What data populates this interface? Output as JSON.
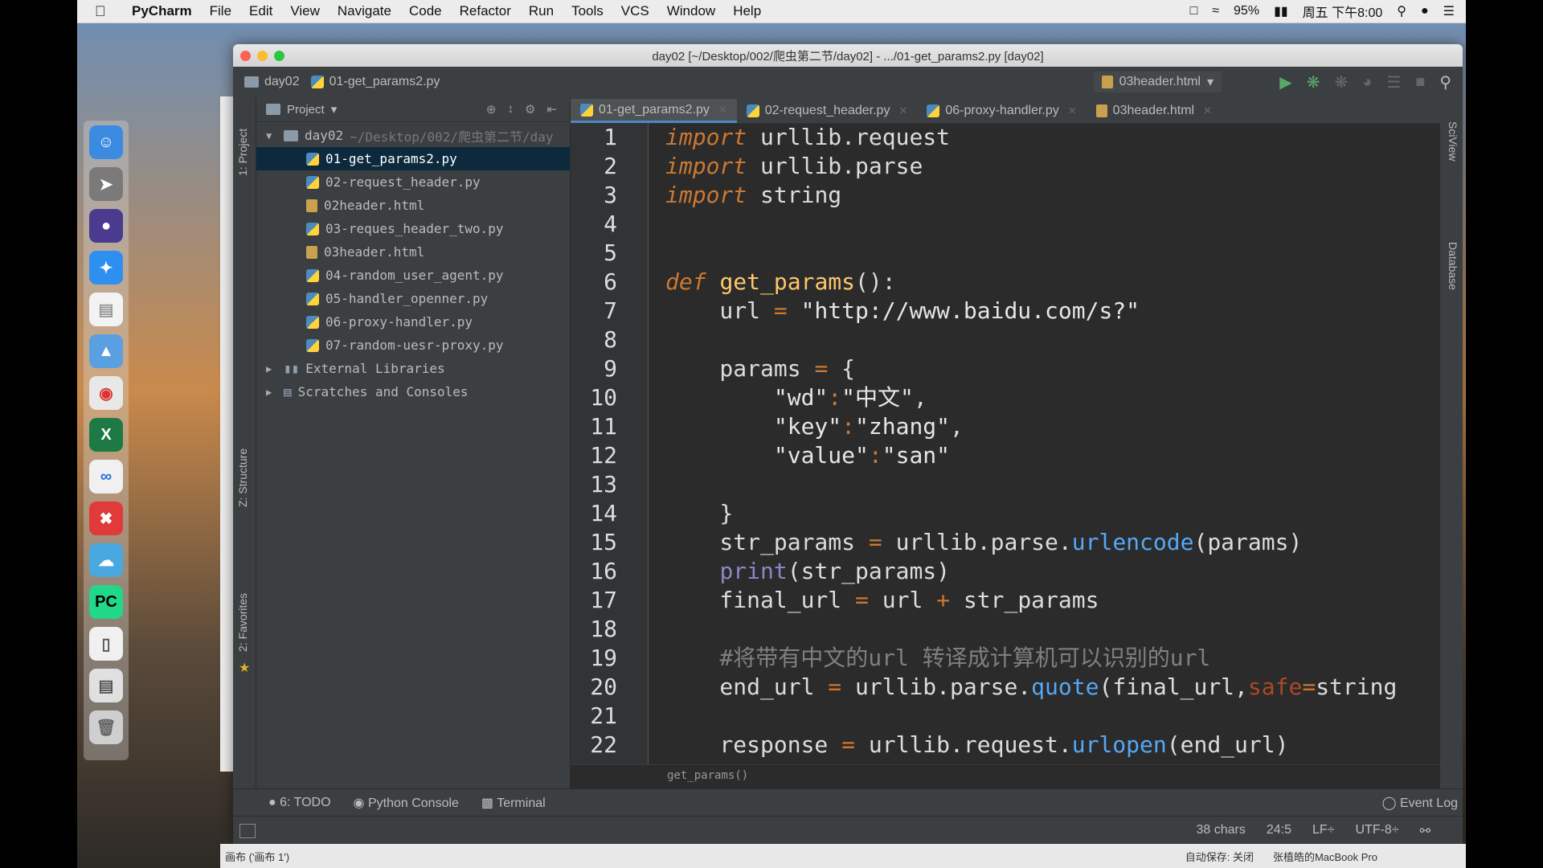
{
  "menubar": {
    "app_name": "PyCharm",
    "items": [
      "File",
      "Edit",
      "View",
      "Navigate",
      "Code",
      "Refactor",
      "Run",
      "Tools",
      "VCS",
      "Window",
      "Help"
    ],
    "battery": "95%",
    "clock": "周五 下午8:00"
  },
  "window": {
    "title": "day02 [~/Desktop/002/爬虫第二节/day02] - .../01-get_params2.py [day02]"
  },
  "navbar": {
    "crumb_project": "day02",
    "crumb_file": "01-get_params2.py",
    "run_config": "03header.html"
  },
  "left_strip": {
    "project_label": "1: Project",
    "structure_label": "Z: Structure",
    "favorites_label": "2: Favorites"
  },
  "right_strip": {
    "sciview_label": "SciView",
    "database_label": "Database"
  },
  "project_panel": {
    "header": "Project",
    "root_name": "day02",
    "root_path": "~/Desktop/002/爬虫第二节/day",
    "files": [
      {
        "name": "01-get_params2.py",
        "type": "py",
        "selected": true
      },
      {
        "name": "02-request_header.py",
        "type": "py",
        "selected": false
      },
      {
        "name": "02header.html",
        "type": "html",
        "selected": false
      },
      {
        "name": "03-reques_header_two.py",
        "type": "py",
        "selected": false
      },
      {
        "name": "03header.html",
        "type": "html",
        "selected": false
      },
      {
        "name": "04-random_user_agent.py",
        "type": "py",
        "selected": false
      },
      {
        "name": "05-handler_openner.py",
        "type": "py",
        "selected": false
      },
      {
        "name": "06-proxy-handler.py",
        "type": "py",
        "selected": false
      },
      {
        "name": "07-random-uesr-proxy.py",
        "type": "py",
        "selected": false
      }
    ],
    "external_libraries": "External Libraries",
    "scratches": "Scratches and Consoles"
  },
  "tabs": [
    {
      "label": "01-get_params2.py",
      "type": "py",
      "active": true
    },
    {
      "label": "02-request_header.py",
      "type": "py",
      "active": false
    },
    {
      "label": "06-proxy-handler.py",
      "type": "py",
      "active": false
    },
    {
      "label": "03header.html",
      "type": "html",
      "active": false
    }
  ],
  "code": {
    "line_numbers": [
      "1",
      "2",
      "3",
      "4",
      "5",
      "6",
      "7",
      "8",
      "9",
      "10",
      "11",
      "12",
      "13",
      "14",
      "15",
      "16",
      "17",
      "18",
      "19",
      "20",
      "21",
      "22"
    ],
    "lines": [
      [
        [
          "kw",
          "import"
        ],
        [
          "plain",
          " urllib.request"
        ]
      ],
      [
        [
          "kw",
          "import"
        ],
        [
          "plain",
          " urllib.parse"
        ]
      ],
      [
        [
          "kw",
          "import"
        ],
        [
          "plain",
          " string"
        ]
      ],
      [],
      [],
      [
        [
          "kw",
          "def"
        ],
        [
          "plain",
          " "
        ],
        [
          "fn",
          "get_params"
        ],
        [
          "plain",
          "():"
        ]
      ],
      [
        [
          "plain",
          "    url "
        ],
        [
          "op",
          "="
        ],
        [
          "plain",
          " "
        ],
        [
          "strw",
          "\"http://www.baidu.com/s?\""
        ]
      ],
      [],
      [
        [
          "plain",
          "    params "
        ],
        [
          "op",
          "="
        ],
        [
          "plain",
          " {"
        ]
      ],
      [
        [
          "plain",
          "        "
        ],
        [
          "strw",
          "\"wd\""
        ],
        [
          "op",
          ":"
        ],
        [
          "strw",
          "\"中文\""
        ],
        [
          "plain",
          ","
        ]
      ],
      [
        [
          "plain",
          "        "
        ],
        [
          "strw",
          "\"key\""
        ],
        [
          "op",
          ":"
        ],
        [
          "strw",
          "\"zhang\""
        ],
        [
          "plain",
          ","
        ]
      ],
      [
        [
          "plain",
          "        "
        ],
        [
          "strw",
          "\"value\""
        ],
        [
          "op",
          ":"
        ],
        [
          "strw",
          "\"san\""
        ]
      ],
      [],
      [
        [
          "plain",
          "    }"
        ]
      ],
      [
        [
          "plain",
          "    str_params "
        ],
        [
          "op",
          "="
        ],
        [
          "plain",
          " urllib.parse."
        ],
        [
          "call",
          "urlencode"
        ],
        [
          "plain",
          "(params)"
        ]
      ],
      [
        [
          "plain",
          "    "
        ],
        [
          "bi",
          "print"
        ],
        [
          "plain",
          "(str_params)"
        ]
      ],
      [
        [
          "plain",
          "    final_url "
        ],
        [
          "op",
          "="
        ],
        [
          "plain",
          " url "
        ],
        [
          "op",
          "+"
        ],
        [
          "plain",
          " str_params"
        ]
      ],
      [],
      [
        [
          "cm",
          "    #将带有中文的url 转译成计算机可以识别的url"
        ]
      ],
      [
        [
          "plain",
          "    end_url "
        ],
        [
          "op",
          "="
        ],
        [
          "plain",
          " urllib.parse."
        ],
        [
          "call",
          "quote"
        ],
        [
          "plain",
          "(final_url,"
        ],
        [
          "kwarg",
          "safe"
        ],
        [
          "op",
          "="
        ],
        [
          "plain",
          "string"
        ]
      ],
      [],
      [
        [
          "plain",
          "    response "
        ],
        [
          "op",
          "="
        ],
        [
          "plain",
          " urllib.request."
        ],
        [
          "call",
          "urlopen"
        ],
        [
          "plain",
          "(end_url)"
        ]
      ]
    ],
    "breadcrumb": "get_params()"
  },
  "bottom_tools": {
    "todo": "6: TODO",
    "python_console": "Python Console",
    "terminal": "Terminal",
    "event_log": "Event Log"
  },
  "status": {
    "chars": "38 chars",
    "position": "24:5",
    "line_sep": "LF÷",
    "encoding": "UTF-8÷"
  },
  "os_bottom": {
    "left_text": "画布 ('画布 1')",
    "autosave": "自动保存: 关闭",
    "macbook": "张植皓的MacBook Pro"
  },
  "colors": {
    "editor_bg": "#2b2b2b",
    "panel_bg": "#3c3f41",
    "keyword": "#cc7832",
    "function": "#ffc66d",
    "call": "#56a8f5",
    "selection": "#0d293e"
  }
}
